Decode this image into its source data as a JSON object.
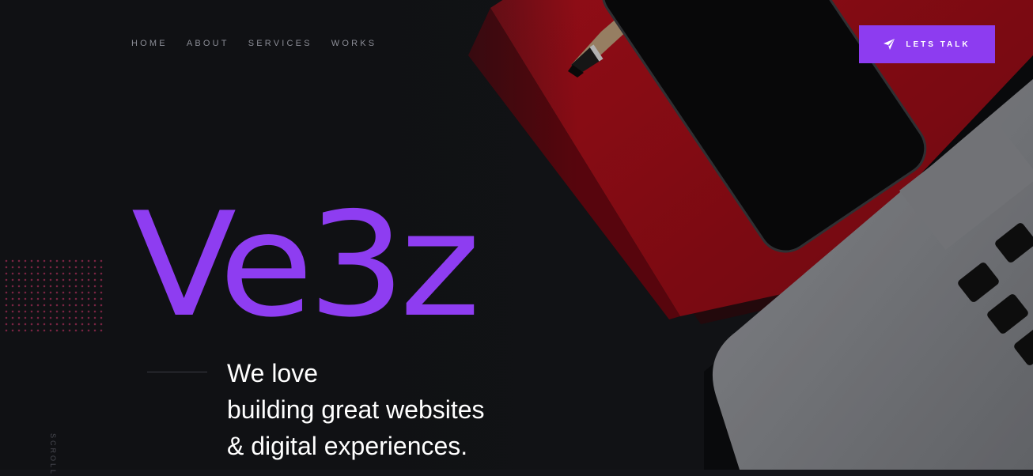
{
  "nav": {
    "items": [
      {
        "label": "HOME"
      },
      {
        "label": "ABOUT"
      },
      {
        "label": "SERVICES"
      },
      {
        "label": "WORKS"
      }
    ]
  },
  "cta": {
    "label": "LETS TALK",
    "icon": "send-icon"
  },
  "hero": {
    "brand": "Ve3z",
    "tagline": [
      "We love",
      "building great websites",
      "& digital experiences."
    ],
    "scroll_label": "SCROLL"
  },
  "colors": {
    "accent": "#8e3df1",
    "background": "#141519",
    "notebook": "#b0131f"
  }
}
